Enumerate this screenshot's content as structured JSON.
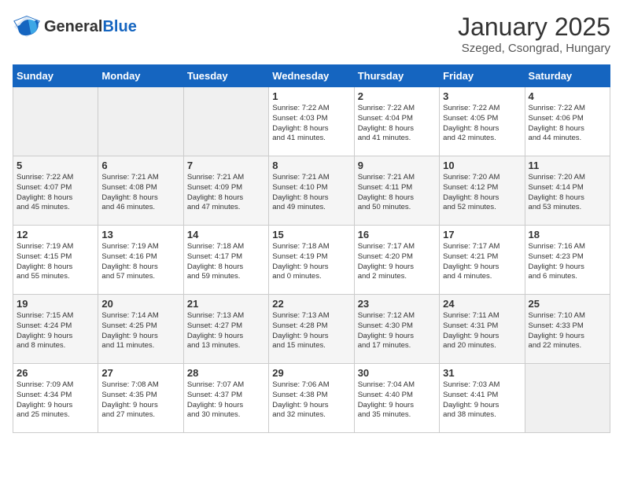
{
  "header": {
    "logo_general": "General",
    "logo_blue": "Blue",
    "title": "January 2025",
    "subtitle": "Szeged, Csongrad, Hungary"
  },
  "days_of_week": [
    "Sunday",
    "Monday",
    "Tuesday",
    "Wednesday",
    "Thursday",
    "Friday",
    "Saturday"
  ],
  "weeks": [
    [
      {
        "day": "",
        "info": ""
      },
      {
        "day": "",
        "info": ""
      },
      {
        "day": "",
        "info": ""
      },
      {
        "day": "1",
        "info": "Sunrise: 7:22 AM\nSunset: 4:03 PM\nDaylight: 8 hours\nand 41 minutes."
      },
      {
        "day": "2",
        "info": "Sunrise: 7:22 AM\nSunset: 4:04 PM\nDaylight: 8 hours\nand 41 minutes."
      },
      {
        "day": "3",
        "info": "Sunrise: 7:22 AM\nSunset: 4:05 PM\nDaylight: 8 hours\nand 42 minutes."
      },
      {
        "day": "4",
        "info": "Sunrise: 7:22 AM\nSunset: 4:06 PM\nDaylight: 8 hours\nand 44 minutes."
      }
    ],
    [
      {
        "day": "5",
        "info": "Sunrise: 7:22 AM\nSunset: 4:07 PM\nDaylight: 8 hours\nand 45 minutes."
      },
      {
        "day": "6",
        "info": "Sunrise: 7:21 AM\nSunset: 4:08 PM\nDaylight: 8 hours\nand 46 minutes."
      },
      {
        "day": "7",
        "info": "Sunrise: 7:21 AM\nSunset: 4:09 PM\nDaylight: 8 hours\nand 47 minutes."
      },
      {
        "day": "8",
        "info": "Sunrise: 7:21 AM\nSunset: 4:10 PM\nDaylight: 8 hours\nand 49 minutes."
      },
      {
        "day": "9",
        "info": "Sunrise: 7:21 AM\nSunset: 4:11 PM\nDaylight: 8 hours\nand 50 minutes."
      },
      {
        "day": "10",
        "info": "Sunrise: 7:20 AM\nSunset: 4:12 PM\nDaylight: 8 hours\nand 52 minutes."
      },
      {
        "day": "11",
        "info": "Sunrise: 7:20 AM\nSunset: 4:14 PM\nDaylight: 8 hours\nand 53 minutes."
      }
    ],
    [
      {
        "day": "12",
        "info": "Sunrise: 7:19 AM\nSunset: 4:15 PM\nDaylight: 8 hours\nand 55 minutes."
      },
      {
        "day": "13",
        "info": "Sunrise: 7:19 AM\nSunset: 4:16 PM\nDaylight: 8 hours\nand 57 minutes."
      },
      {
        "day": "14",
        "info": "Sunrise: 7:18 AM\nSunset: 4:17 PM\nDaylight: 8 hours\nand 59 minutes."
      },
      {
        "day": "15",
        "info": "Sunrise: 7:18 AM\nSunset: 4:19 PM\nDaylight: 9 hours\nand 0 minutes."
      },
      {
        "day": "16",
        "info": "Sunrise: 7:17 AM\nSunset: 4:20 PM\nDaylight: 9 hours\nand 2 minutes."
      },
      {
        "day": "17",
        "info": "Sunrise: 7:17 AM\nSunset: 4:21 PM\nDaylight: 9 hours\nand 4 minutes."
      },
      {
        "day": "18",
        "info": "Sunrise: 7:16 AM\nSunset: 4:23 PM\nDaylight: 9 hours\nand 6 minutes."
      }
    ],
    [
      {
        "day": "19",
        "info": "Sunrise: 7:15 AM\nSunset: 4:24 PM\nDaylight: 9 hours\nand 8 minutes."
      },
      {
        "day": "20",
        "info": "Sunrise: 7:14 AM\nSunset: 4:25 PM\nDaylight: 9 hours\nand 11 minutes."
      },
      {
        "day": "21",
        "info": "Sunrise: 7:13 AM\nSunset: 4:27 PM\nDaylight: 9 hours\nand 13 minutes."
      },
      {
        "day": "22",
        "info": "Sunrise: 7:13 AM\nSunset: 4:28 PM\nDaylight: 9 hours\nand 15 minutes."
      },
      {
        "day": "23",
        "info": "Sunrise: 7:12 AM\nSunset: 4:30 PM\nDaylight: 9 hours\nand 17 minutes."
      },
      {
        "day": "24",
        "info": "Sunrise: 7:11 AM\nSunset: 4:31 PM\nDaylight: 9 hours\nand 20 minutes."
      },
      {
        "day": "25",
        "info": "Sunrise: 7:10 AM\nSunset: 4:33 PM\nDaylight: 9 hours\nand 22 minutes."
      }
    ],
    [
      {
        "day": "26",
        "info": "Sunrise: 7:09 AM\nSunset: 4:34 PM\nDaylight: 9 hours\nand 25 minutes."
      },
      {
        "day": "27",
        "info": "Sunrise: 7:08 AM\nSunset: 4:35 PM\nDaylight: 9 hours\nand 27 minutes."
      },
      {
        "day": "28",
        "info": "Sunrise: 7:07 AM\nSunset: 4:37 PM\nDaylight: 9 hours\nand 30 minutes."
      },
      {
        "day": "29",
        "info": "Sunrise: 7:06 AM\nSunset: 4:38 PM\nDaylight: 9 hours\nand 32 minutes."
      },
      {
        "day": "30",
        "info": "Sunrise: 7:04 AM\nSunset: 4:40 PM\nDaylight: 9 hours\nand 35 minutes."
      },
      {
        "day": "31",
        "info": "Sunrise: 7:03 AM\nSunset: 4:41 PM\nDaylight: 9 hours\nand 38 minutes."
      },
      {
        "day": "",
        "info": ""
      }
    ]
  ]
}
